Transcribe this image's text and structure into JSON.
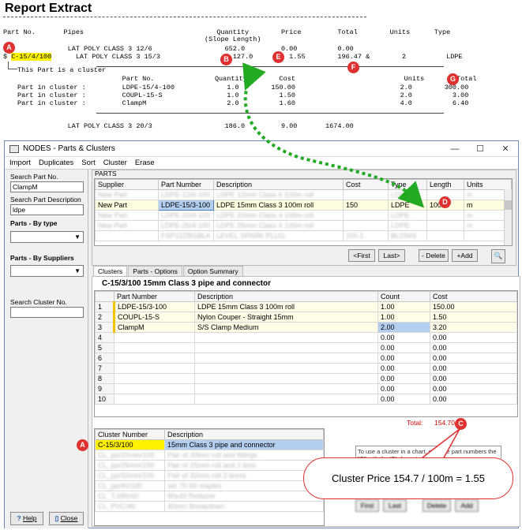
{
  "report": {
    "title": "Report Extract",
    "header_line1": "Part No.       Pipes                                 Quantity        Price         Total        Units      Type",
    "header_line2": "                                                  (Slope Length)",
    "row1": "                LAT POLY CLASS 3 12/6                  652.0         0.00          0.00",
    "row2_part": "C-15/4/100",
    "row2_rest": "LAT POLY CLASS 3 15/3                  127.0         1.55        196.47 &        2          LDPE",
    "note": "This Part is a cluster",
    "sub_header": "                          Part No.               Quantity        Cost                           Units        Total",
    "sub_rows": [
      "Part in cluster :         LDPE-15/4-100             1.0        150.00                          2.0        300.00",
      "Part in cluster :         COUPL-15-S                1.0          1.50                          2.0          3.00",
      "Part in cluster :         ClampM                    2.0          1.60                          4.0          6.40"
    ],
    "row3": "                LAT POLY CLASS 3 20/3                  186.0         9.00       1674.00"
  },
  "markers": {
    "a": "A",
    "b": "B",
    "c": "C",
    "d": "D",
    "e": "E",
    "f": "F",
    "g": "G"
  },
  "window": {
    "title": "NODES - Parts & Clusters",
    "menu": [
      "Import",
      "Duplicates",
      "Sort",
      "Cluster",
      "Erase"
    ],
    "controls": {
      "minimize": "—",
      "maximize": "☐",
      "close": "✕"
    }
  },
  "left": {
    "search_part_label": "Search Part No.",
    "search_part_value": "ClampM",
    "search_desc_label": "Search Part Description",
    "search_desc_value": "ldpe",
    "by_type_label": "Parts - By type",
    "by_suppliers_label": "Parts - By Suppliers",
    "search_cluster_label": "Search Cluster No.",
    "help_label": "Help",
    "close_label": "Close"
  },
  "parts": {
    "frame_label": "PARTS",
    "columns": [
      "Supplier",
      "Part Number",
      "Description",
      "Cost",
      "Type",
      "Length",
      "Units"
    ],
    "blur_row_above": [
      "New Part",
      "LDPE-12/6-100",
      "LDPE 12mm Class 6 100m roll",
      "",
      "LDPE",
      "",
      "m"
    ],
    "selected_row": [
      "New Part",
      "LDPE-15/3-100",
      "LDPE 15mm Class 3 100m roll",
      "150",
      "LDPE",
      "100",
      "m"
    ],
    "blur_rows_below": [
      [
        "New Part",
        "LDPE-20/4-100",
        "LDPE 20mm Class 4 100m roll",
        "",
        "LDPE",
        "",
        "m"
      ],
      [
        "New Part",
        "LDPE-25/4-100",
        "LDPE 25mm Class 4 100m roll",
        "",
        "LDPE",
        "",
        "m"
      ],
      [
        "",
        "FSP12ZBGBLK",
        "LEVEL SPARK PLUG",
        "200.1",
        "BLOWS",
        "",
        ""
      ]
    ],
    "buttons": {
      "first": "<First",
      "last": "Last>",
      "delete": "- Delete",
      "add": "+Add"
    }
  },
  "tabs": [
    "Clusters",
    "Parts - Options",
    "Option Summary"
  ],
  "cluster": {
    "title": "C-15/3/100    15mm Class 3 pipe and connector",
    "columns": [
      "",
      "Part Number",
      "Description",
      "Count",
      "Cost"
    ],
    "rows": [
      [
        "1",
        "LDPE-15/3-100",
        "LDPE 15mm Class 3 100m roll",
        "1.00",
        "150.00"
      ],
      [
        "2",
        "COUPL-15-S",
        "Nylon Couper - Straight 15mm",
        "1.00",
        "1.50"
      ],
      [
        "3",
        "ClampM",
        "S/S Clamp Medium",
        "2.00",
        "3.20"
      ],
      [
        "4",
        "",
        "",
        "0.00",
        "0.00"
      ],
      [
        "5",
        "",
        "",
        "0.00",
        "0.00"
      ],
      [
        "6",
        "",
        "",
        "0.00",
        "0.00"
      ],
      [
        "7",
        "",
        "",
        "0.00",
        "0.00"
      ],
      [
        "8",
        "",
        "",
        "0.00",
        "0.00"
      ],
      [
        "9",
        "",
        "",
        "0.00",
        "0.00"
      ],
      [
        "10",
        "",
        "",
        "0.00",
        "0.00"
      ]
    ],
    "total_label": "Total:",
    "total_value": "154.70",
    "list_columns": [
      "Cluster Number",
      "Description"
    ],
    "list_selected": [
      "C-15/3/100",
      "15mm Class 3 pipe and connector"
    ],
    "list_blur_rows": [
      [
        "CL_pp/20mm/100",
        "Pair of 20mm roll and fittings"
      ],
      [
        "CL_pp/25mm/150",
        "Pair of 25mm roll and 2 tees"
      ],
      [
        "CL_pp/32mm/100",
        "Pair of 32mm roll 2 teess"
      ],
      [
        "CL_pp/40/100",
        "set 75-90 staples"
      ],
      [
        "CL_TJ/80/40",
        "80x40 Reducer"
      ],
      [
        "CL_PVC/40",
        "40mm Breakdown"
      ]
    ],
    "hint": "To use a cluster in a chart, start the part numbers the \"C\" with the 'C' character",
    "blur_buttons": [
      "First",
      "Last",
      "Delete",
      "Add"
    ]
  },
  "callout": "Cluster Price 154.7 / 100m = 1.55",
  "colors": {
    "marker": "#e03131",
    "highlight": "#fff200",
    "arrow": "#22aa22",
    "selection": "#b4cef0"
  }
}
